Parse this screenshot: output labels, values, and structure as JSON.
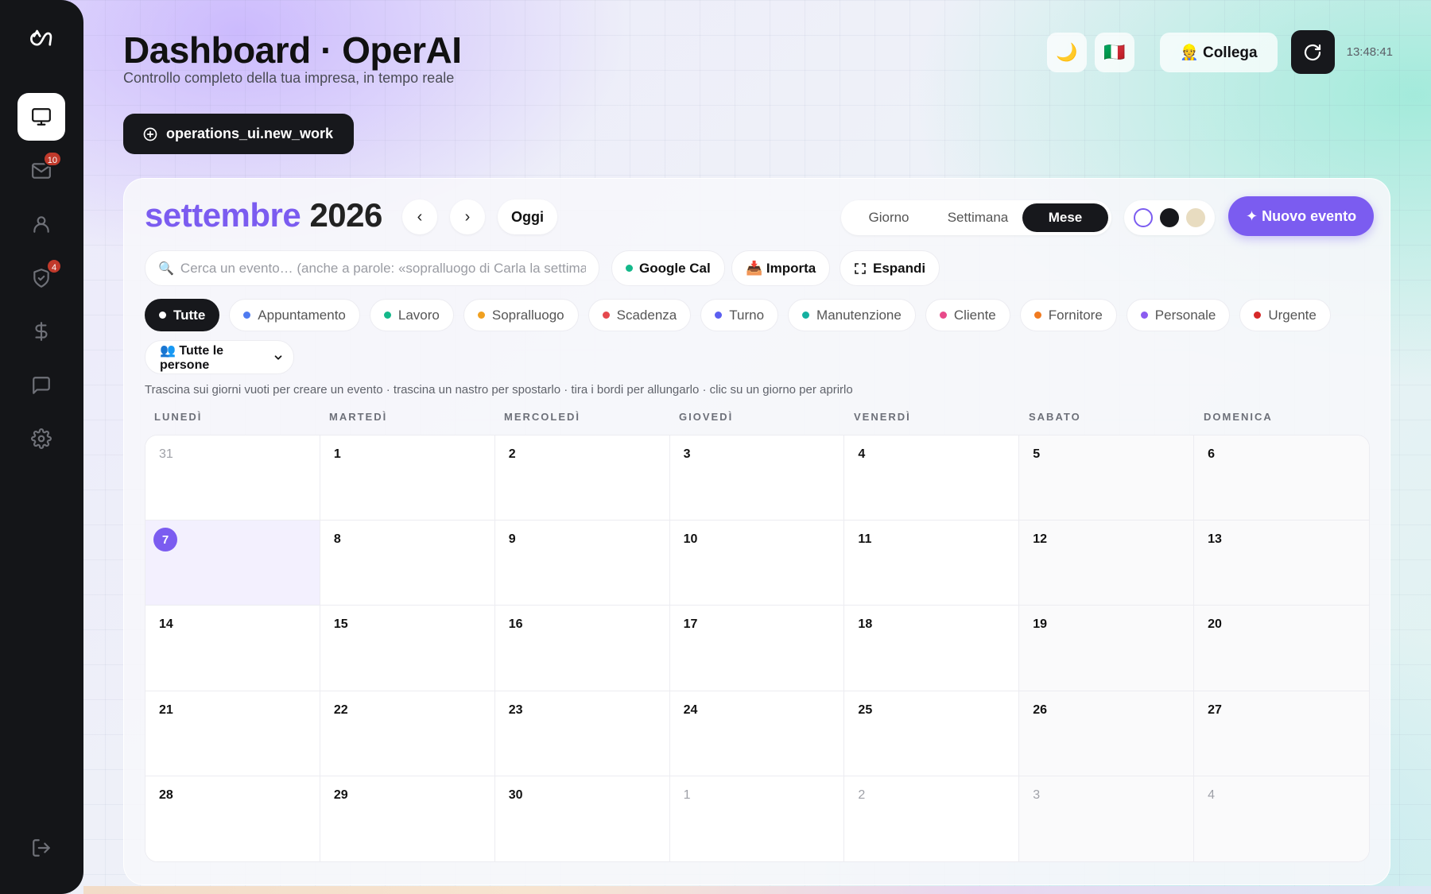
{
  "header": {
    "title": "Dashboard · OperAI",
    "subtitle": "Controllo completo della tua impresa, in tempo reale",
    "new_work_label": "operations_ui.new_work",
    "moon_glyph": "🌙",
    "flag_glyph": "🇮🇹",
    "connect_label": "👷 Collega",
    "clock": "13:48:41"
  },
  "sidebar": {
    "badges": {
      "mail": "10",
      "security": "4"
    }
  },
  "calendar": {
    "month": "settembre",
    "year": "2026",
    "prev_glyph": "‹",
    "next_glyph": "›",
    "today_label": "Oggi",
    "views": {
      "day": "Giorno",
      "week": "Settimana",
      "month": "Mese"
    },
    "theme_colors": {
      "outline": "#7b5cf0",
      "dark": "#17181c",
      "sand": "#e8dcc0"
    },
    "new_event_label": "✦ Nuovo evento",
    "search_placeholder": "Cerca un evento… (anche a parole: «sopralluogo di Carla la settimana prossima»)",
    "google_cal_label": "Google Cal",
    "import_label": "📥 Importa",
    "expand_label": "Espandi",
    "filters": {
      "all": "Tutte",
      "appointment": "Appuntamento",
      "work": "Lavoro",
      "inspection": "Sopralluogo",
      "deadline": "Scadenza",
      "shift": "Turno",
      "maintenance": "Manutenzione",
      "client": "Cliente",
      "supplier": "Fornitore",
      "personal": "Personale",
      "urgent": "Urgente"
    },
    "filter_colors": {
      "appointment": "#4f7bf0",
      "work": "#14b88a",
      "inspection": "#f0a020",
      "deadline": "#e5484d",
      "shift": "#5b5ff0",
      "maintenance": "#14b0a0",
      "client": "#e84a8a",
      "supplier": "#f07a20",
      "personal": "#8b5cf0",
      "urgent": "#d62828",
      "google": "#14b88a"
    },
    "people_select": "👥 Tutte le persone",
    "hint": "Trascina sui giorni vuoti per creare un evento · trascina un nastro per spostarlo · tira i bordi per allungarlo · clic su un giorno per aprirlo",
    "weekdays": [
      "LUNEDÌ",
      "MARTEDÌ",
      "MERCOLEDÌ",
      "GIOVEDÌ",
      "VENERDÌ",
      "SABATO",
      "DOMENICA"
    ],
    "days": [
      "31",
      "1",
      "2",
      "3",
      "4",
      "5",
      "6",
      "7",
      "8",
      "9",
      "10",
      "11",
      "12",
      "13",
      "14",
      "15",
      "16",
      "17",
      "18",
      "19",
      "20",
      "21",
      "22",
      "23",
      "24",
      "25",
      "26",
      "27",
      "28",
      "29",
      "30",
      "1",
      "2",
      "3",
      "4"
    ]
  }
}
